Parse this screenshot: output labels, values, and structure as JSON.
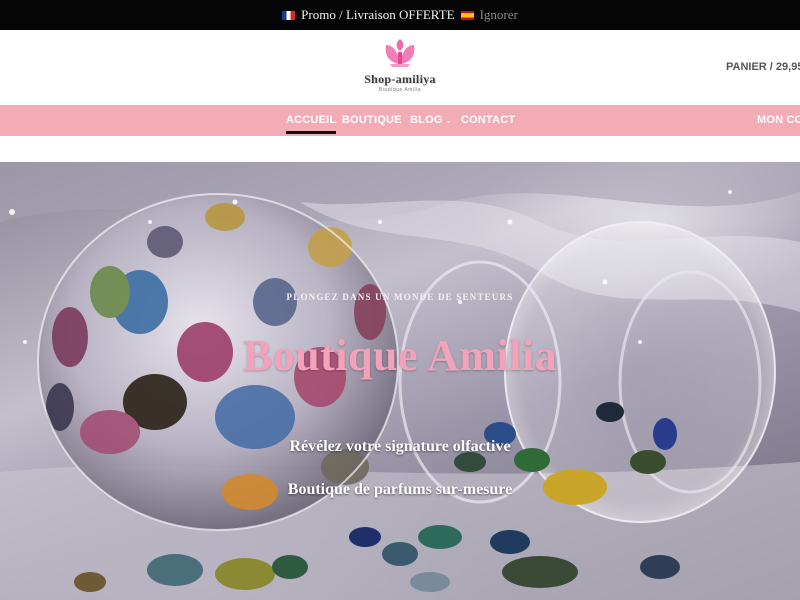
{
  "topbar": {
    "promo_text": "Promo / Livraison OFFERTE",
    "dismiss_label": "Ignorer",
    "promo_flag": "flag-fr",
    "lang_flag": "flag-es"
  },
  "header": {
    "logo_text": "Shop-amiliya",
    "logo_tagline": "Boutique Amilia",
    "cart_label": "PANIER / 29,95"
  },
  "nav": {
    "items": [
      {
        "label": "ACCUEIL",
        "active": true
      },
      {
        "label": "BOUTIQUE",
        "active": false
      },
      {
        "label": "BLOG",
        "active": false,
        "has_dropdown": true
      },
      {
        "label": "CONTACT",
        "active": false
      }
    ],
    "account_label": "MON CO",
    "background": "#f3abb6"
  },
  "hero": {
    "eyebrow": "PLONGEZ DANS UN MONDE DE SENTEURS",
    "title": "Boutique Amilia",
    "line1": "Révélez votre signature olfactive",
    "line2": "Boutique de parfums sur-mesure",
    "title_color": "#f2a2ba"
  }
}
